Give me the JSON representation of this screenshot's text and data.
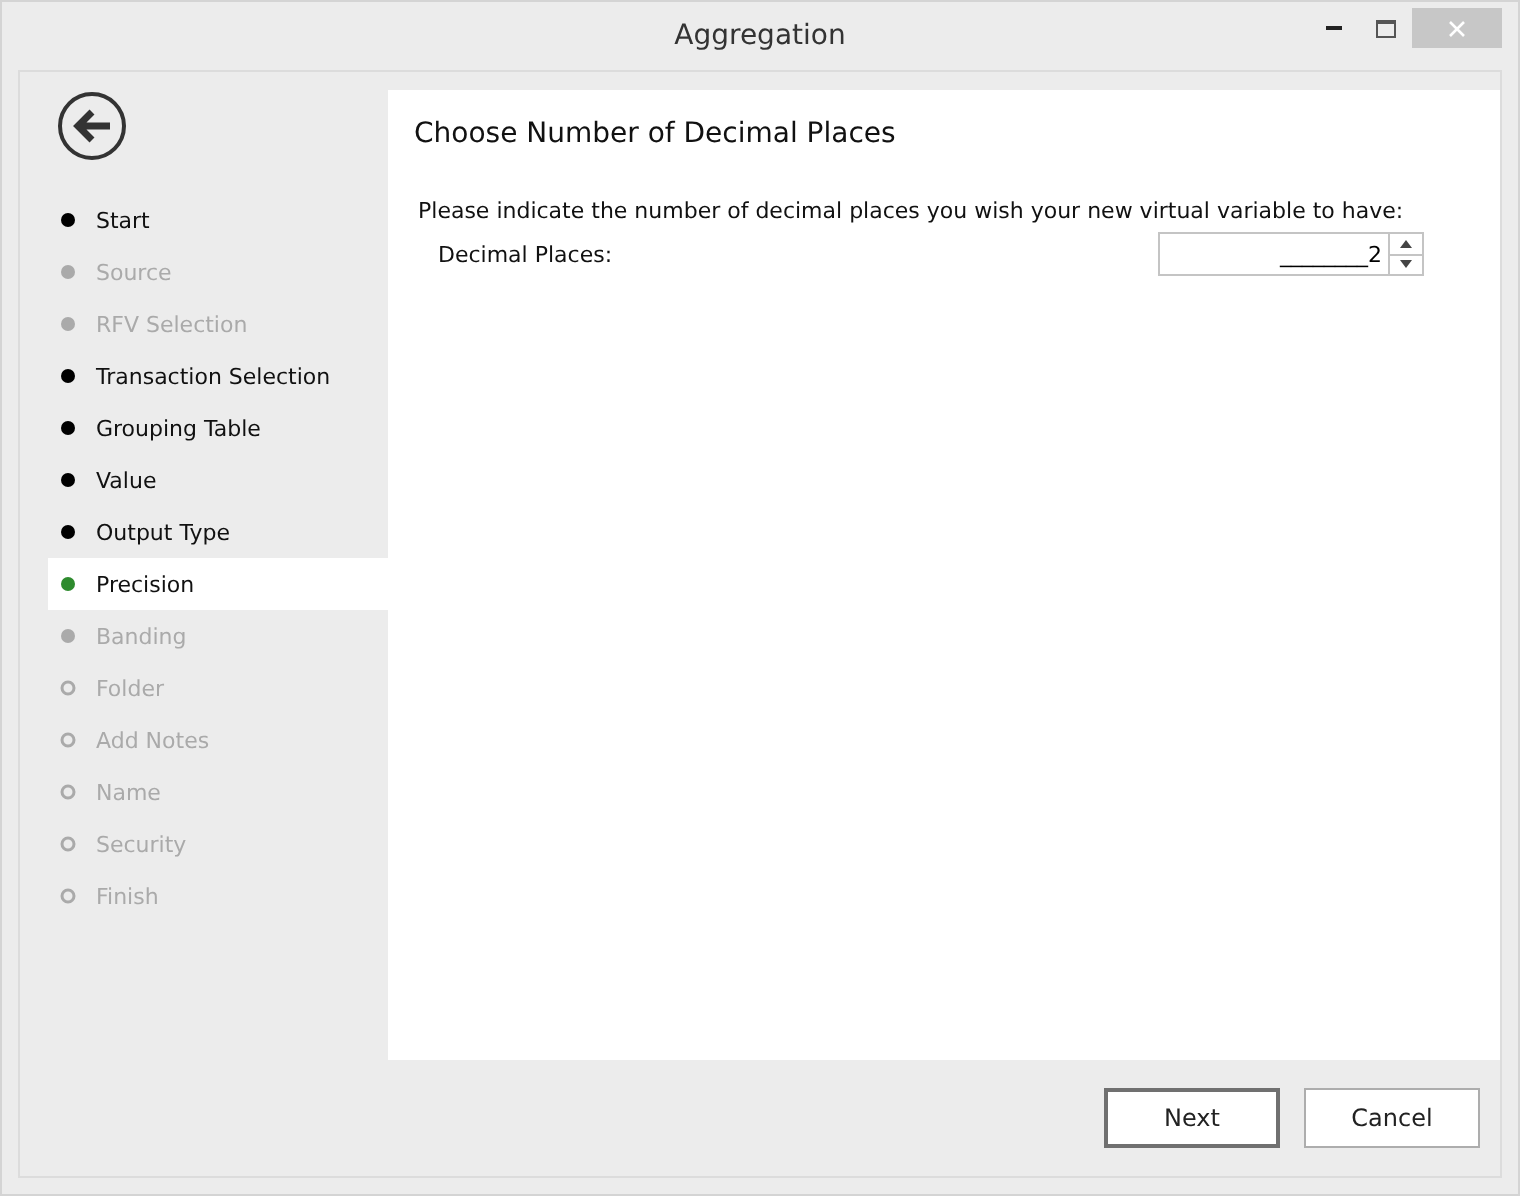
{
  "window": {
    "title": "Aggregation"
  },
  "steps": [
    {
      "label": "Start",
      "kind": "done",
      "selected": false
    },
    {
      "label": "Source",
      "kind": "skipped",
      "selected": false
    },
    {
      "label": "RFV Selection",
      "kind": "skipped",
      "selected": false
    },
    {
      "label": "Transaction Selection",
      "kind": "done",
      "selected": false
    },
    {
      "label": "Grouping Table",
      "kind": "done",
      "selected": false
    },
    {
      "label": "Value",
      "kind": "done",
      "selected": false
    },
    {
      "label": "Output Type",
      "kind": "done",
      "selected": false
    },
    {
      "label": "Precision",
      "kind": "current",
      "selected": true
    },
    {
      "label": "Banding",
      "kind": "skipped",
      "selected": false
    },
    {
      "label": "Folder",
      "kind": "pending",
      "selected": false
    },
    {
      "label": "Add Notes",
      "kind": "pending",
      "selected": false
    },
    {
      "label": "Name",
      "kind": "pending",
      "selected": false
    },
    {
      "label": "Security",
      "kind": "pending",
      "selected": false
    },
    {
      "label": "Finish",
      "kind": "pending",
      "selected": false
    }
  ],
  "page": {
    "heading": "Choose Number of Decimal Places",
    "instruction": "Please indicate the number of decimal places you wish your new virtual variable to have:",
    "field_label": "Decimal Places:",
    "value": "________2"
  },
  "buttons": [
    {
      "label": "Next",
      "kind": "default"
    },
    {
      "label": "Cancel",
      "kind": "normal"
    }
  ]
}
